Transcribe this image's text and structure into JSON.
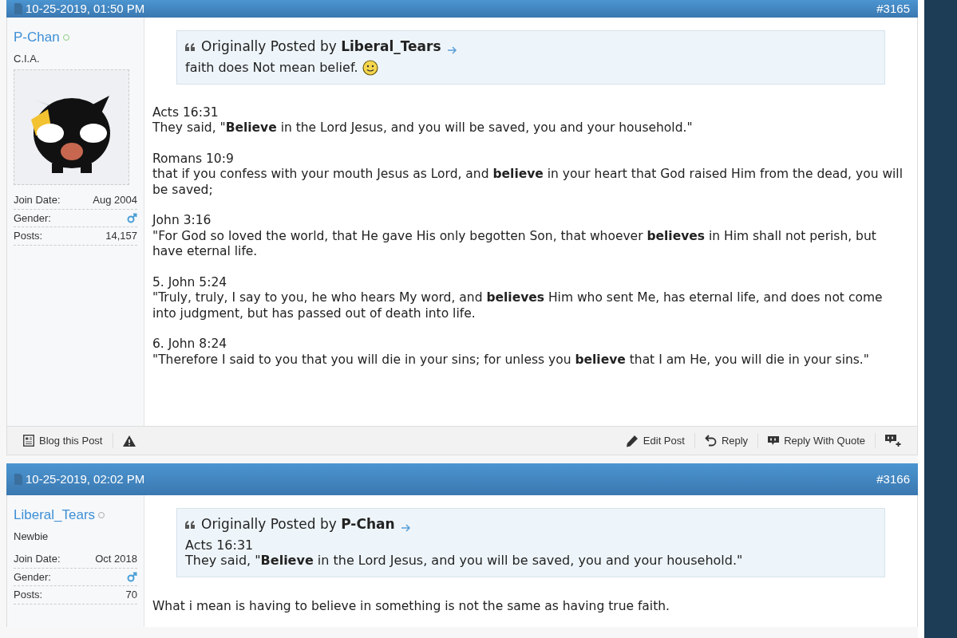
{
  "posts": [
    {
      "date": "10-25-2019, 01:50 PM",
      "number": "#3165",
      "user": {
        "name": "P-Chan",
        "online": true,
        "title": "C.I.A.",
        "avatar": true,
        "details": [
          {
            "kind": "text",
            "label": "Join Date:",
            "value": "Aug 2004"
          },
          {
            "kind": "male",
            "label": "Gender:"
          },
          {
            "kind": "text",
            "label": "Posts:",
            "value": "14,157"
          }
        ]
      },
      "quote": {
        "prefix": "Originally Posted by",
        "author": "Liberal_Tears",
        "paragraphs": [
          "faith does Not mean belief."
        ],
        "smiley": true
      },
      "paragraphs": [
        "Acts 16:31\nThey said, \"**Believe** in the Lord Jesus, and you will be saved, you and your household.\"",
        "Romans 10:9\nthat if you confess with your mouth Jesus as Lord, and **believe** in your heart that God raised Him from the dead, you will be saved;",
        "John 3:16\n\"For God so loved the world, that He gave His only begotten Son, that whoever **believes** in Him shall not perish, but have eternal life.",
        "5. John 5:24\n\"Truly, truly, I say to you, he who hears My word, and **believes** Him who sent Me, has eternal life, and does not come into judgment, but has passed out of death into life.",
        "6. John 8:24\n\"Therefore I said to you that you will die in your sins; for unless you **believe** that I am He, you will die in your sins.\""
      ],
      "footer": {
        "left": [
          {
            "kind": "blog",
            "label": "Blog this Post"
          },
          {
            "kind": "report"
          }
        ],
        "right": [
          {
            "kind": "edit",
            "label": "Edit Post"
          },
          {
            "kind": "reply",
            "label": "Reply"
          },
          {
            "kind": "quote",
            "label": "Reply With Quote"
          },
          {
            "kind": "multiquote"
          }
        ]
      }
    },
    {
      "date": "10-25-2019, 02:02 PM",
      "number": "#3166",
      "user": {
        "name": "Liberal_Tears",
        "online": false,
        "title": "Newbie",
        "avatar": false,
        "details": [
          {
            "kind": "text",
            "label": "Join Date:",
            "value": "Oct 2018"
          },
          {
            "kind": "male",
            "label": "Gender:"
          },
          {
            "kind": "text",
            "label": "Posts:",
            "value": "70"
          }
        ]
      },
      "quote": {
        "prefix": "Originally Posted by",
        "author": "P-Chan",
        "paragraphs": [
          "Acts 16:31\nThey said, \"**Believe** in the Lord Jesus, and you will be saved, you and your household.\""
        ],
        "smiley": false
      },
      "paragraphs": [
        "What i mean is having to believe in something is not the same as having true faith."
      ]
    }
  ]
}
